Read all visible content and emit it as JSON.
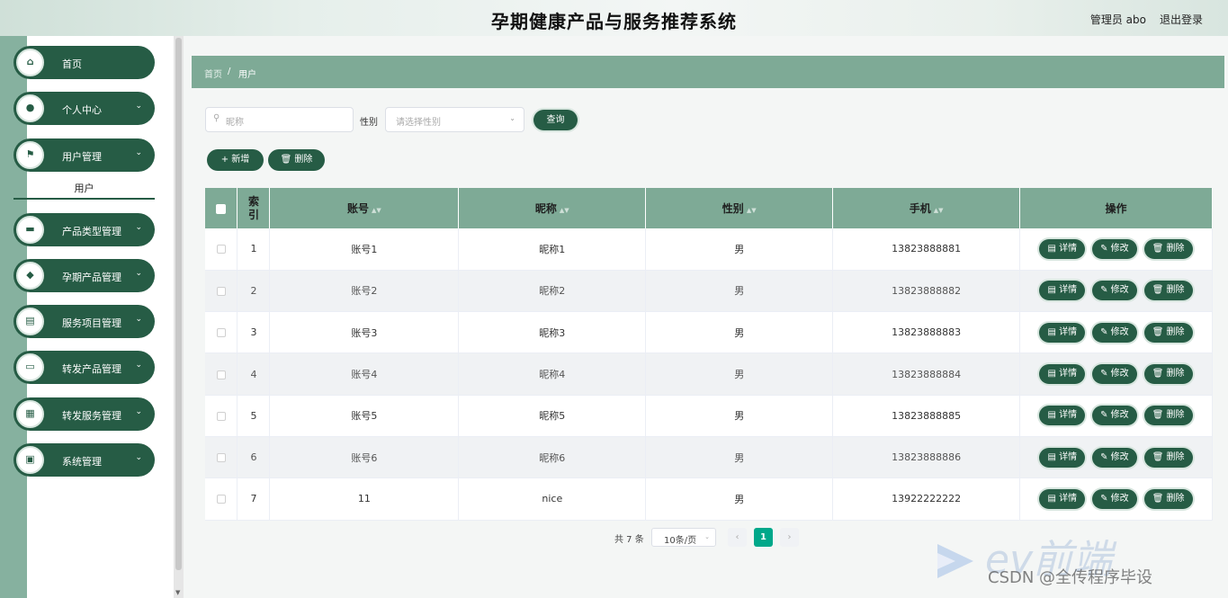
{
  "header": {
    "title": "孕期健康产品与服务推荐系统",
    "user": "管理员 abo",
    "logout": "退出登录"
  },
  "sidebar": {
    "items": [
      {
        "label": "首页",
        "icon": "⌂",
        "chevron": ""
      },
      {
        "label": "个人中心",
        "icon": "●",
        "chevron": "⌄"
      },
      {
        "label": "用户管理",
        "icon": "⚑",
        "chevron": "⌄"
      },
      {
        "label": "产品类型管理",
        "icon": "▬",
        "chevron": "⌄"
      },
      {
        "label": "孕期产品管理",
        "icon": "◆",
        "chevron": "⌄"
      },
      {
        "label": "服务项目管理",
        "icon": "▤",
        "chevron": "⌄"
      },
      {
        "label": "转发产品管理",
        "icon": "▭",
        "chevron": "⌄"
      },
      {
        "label": "转发服务管理",
        "icon": "▦",
        "chevron": "⌄"
      },
      {
        "label": "系统管理",
        "icon": "▣",
        "chevron": "⌄"
      }
    ],
    "submenu": "用户"
  },
  "breadcrumb": {
    "home": "首页",
    "sep": "/",
    "current": "用户"
  },
  "filters": {
    "nickname_placeholder": "昵称",
    "gender_label": "性别",
    "gender_placeholder": "请选择性别",
    "query": "查询"
  },
  "actions": {
    "add": "+ 新增",
    "delete": "🗑 删除"
  },
  "table": {
    "headers": [
      "索引",
      "账号",
      "昵称",
      "性别",
      "手机",
      "操作"
    ],
    "ops": {
      "detail": "▤ 详情",
      "edit": "✎ 修改",
      "delete": "🗑 删除"
    },
    "rows": [
      {
        "index": "1",
        "account": "账号1",
        "nickname": "昵称1",
        "gender": "男",
        "phone": "13823888881"
      },
      {
        "index": "2",
        "account": "账号2",
        "nickname": "昵称2",
        "gender": "男",
        "phone": "13823888882"
      },
      {
        "index": "3",
        "account": "账号3",
        "nickname": "昵称3",
        "gender": "男",
        "phone": "13823888883"
      },
      {
        "index": "4",
        "account": "账号4",
        "nickname": "昵称4",
        "gender": "男",
        "phone": "13823888884"
      },
      {
        "index": "5",
        "account": "账号5",
        "nickname": "昵称5",
        "gender": "男",
        "phone": "13823888885"
      },
      {
        "index": "6",
        "account": "账号6",
        "nickname": "昵称6",
        "gender": "男",
        "phone": "13823888886"
      },
      {
        "index": "7",
        "account": "11",
        "nickname": "nice",
        "gender": "男",
        "phone": "13922222222"
      }
    ]
  },
  "pagination": {
    "total": "共 7 条",
    "page_size": "10条/页",
    "current": "1",
    "prev": "‹",
    "next": "›"
  },
  "watermark": {
    "brand": "ev前端",
    "text": "CSDN @全传程序毕设"
  },
  "colors": {
    "primary": "#265c45",
    "header_green": "#7eaa96",
    "accent": "#00a88a"
  }
}
